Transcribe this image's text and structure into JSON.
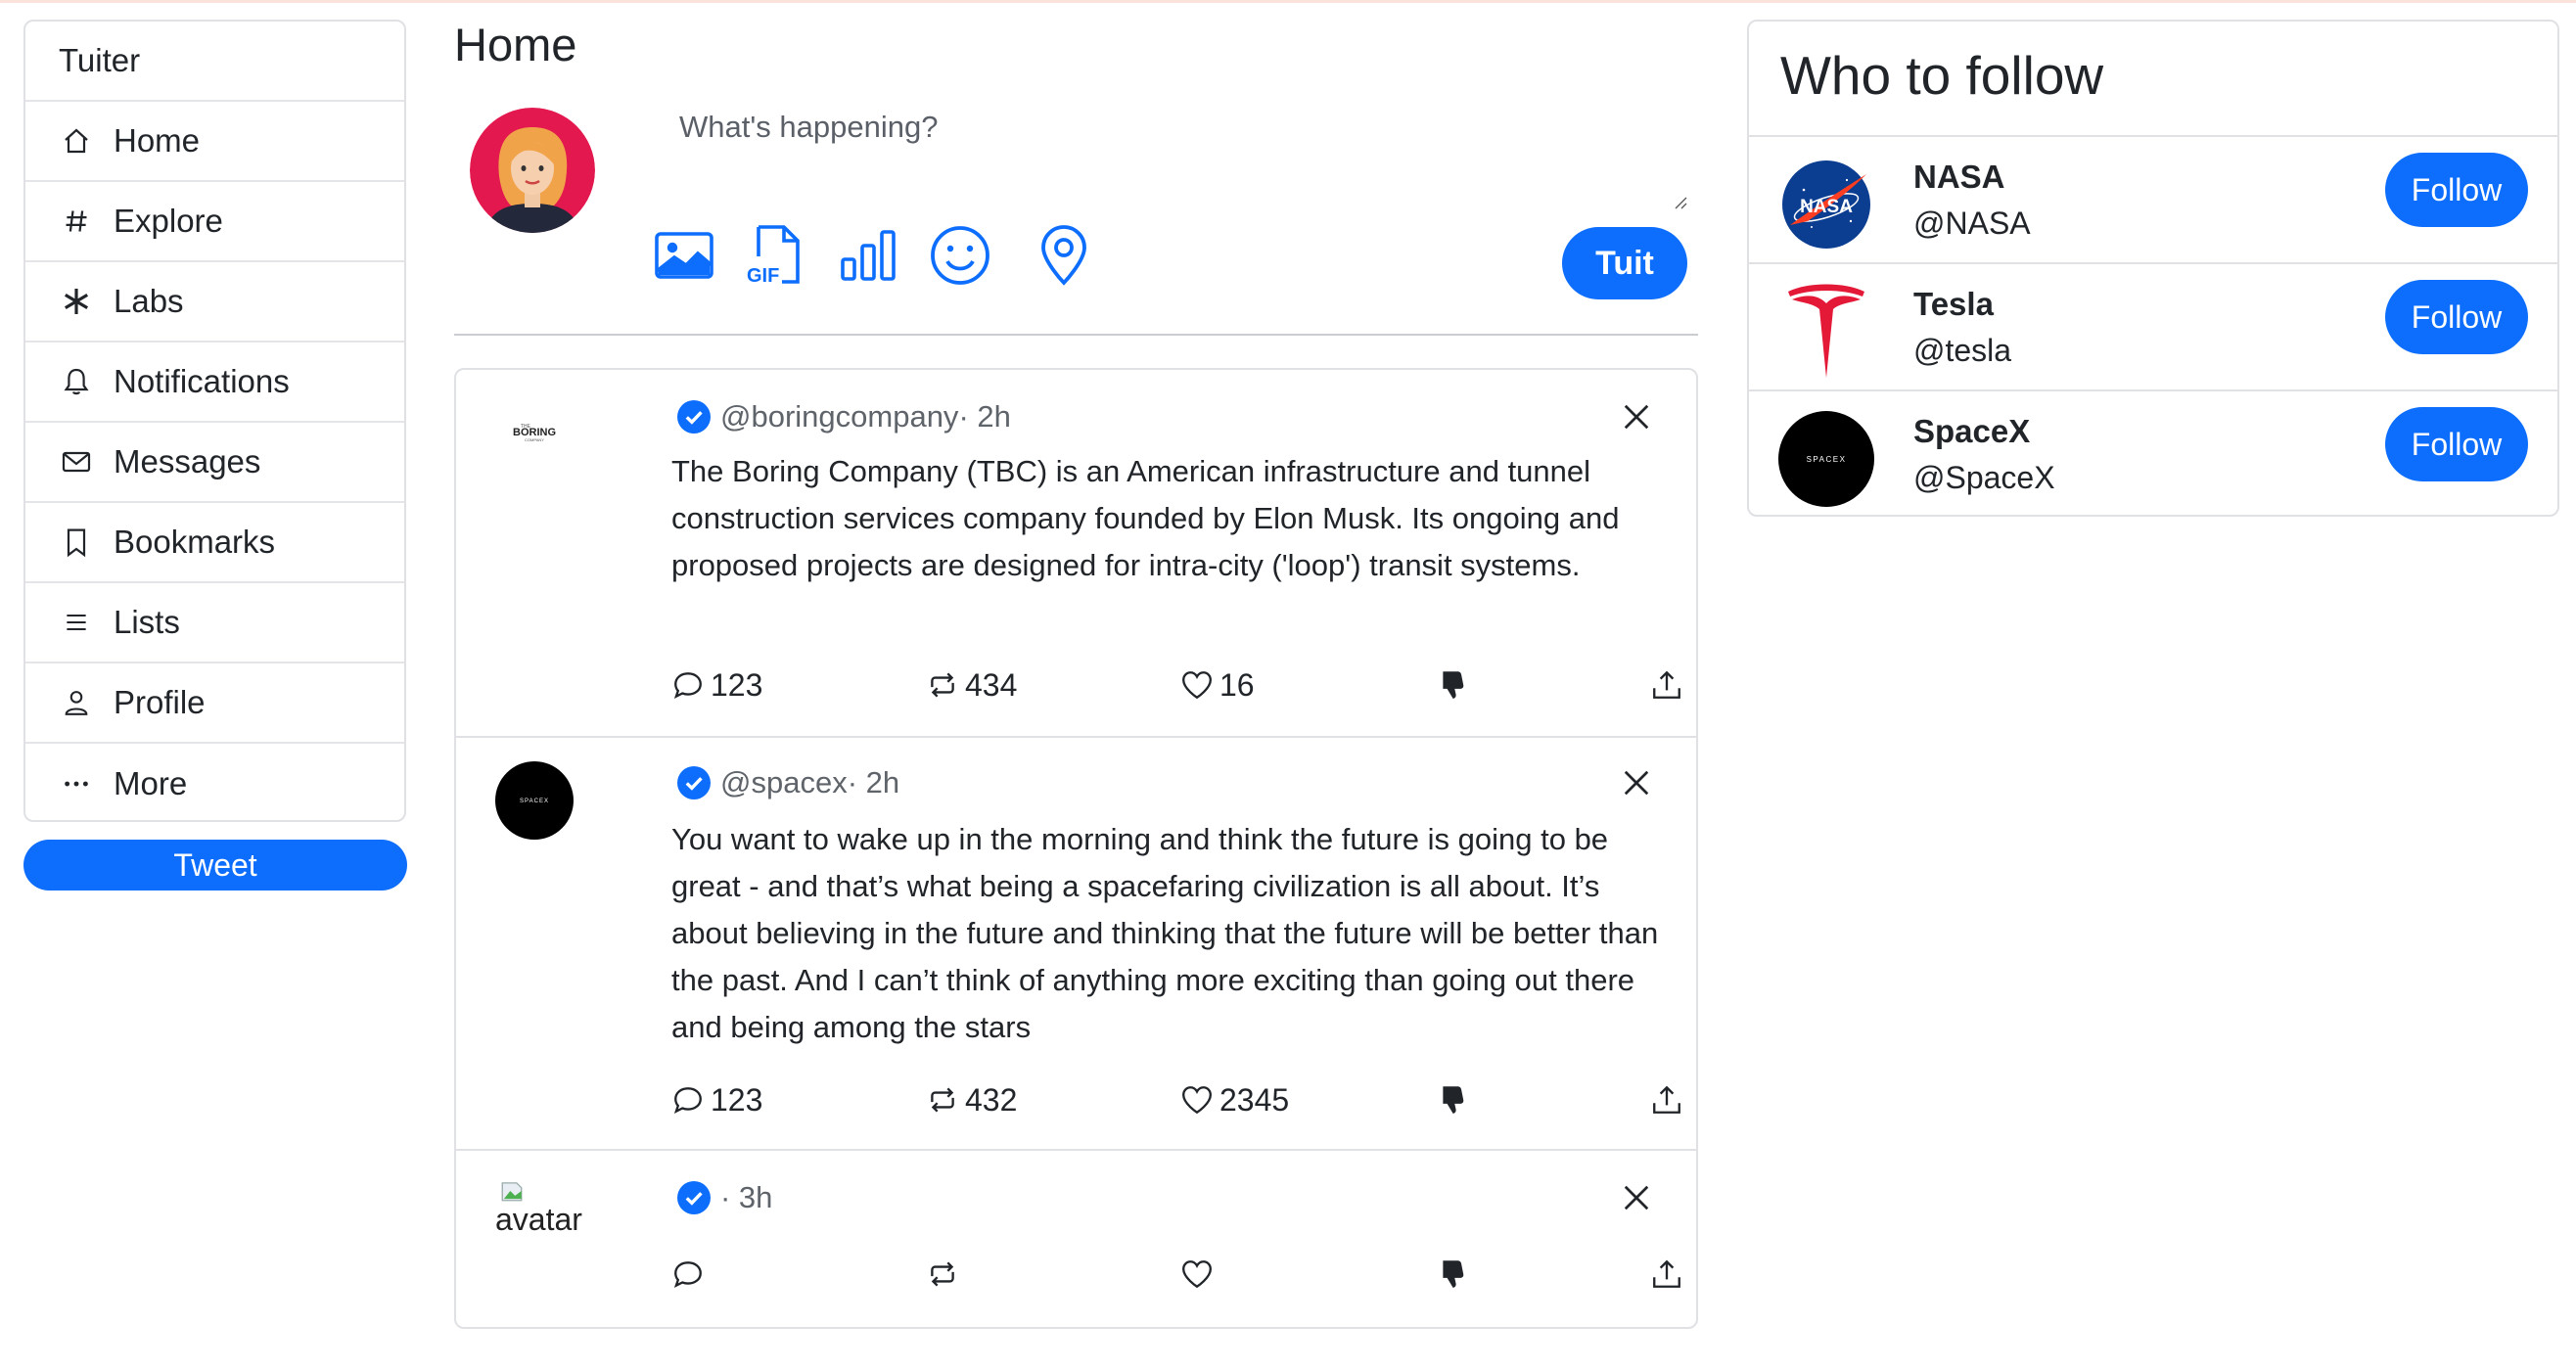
{
  "nav": {
    "brand": "Tuiter",
    "items": [
      {
        "label": "Home",
        "icon": "home-icon"
      },
      {
        "label": "Explore",
        "icon": "hash-icon"
      },
      {
        "label": "Labs",
        "icon": "asterisk-icon"
      },
      {
        "label": "Notifications",
        "icon": "bell-icon"
      },
      {
        "label": "Messages",
        "icon": "envelope-icon"
      },
      {
        "label": "Bookmarks",
        "icon": "bookmark-icon"
      },
      {
        "label": "Lists",
        "icon": "list-icon"
      },
      {
        "label": "Profile",
        "icon": "person-icon"
      },
      {
        "label": "More",
        "icon": "more-icon"
      }
    ],
    "tweet_button": "Tweet"
  },
  "main": {
    "title": "Home",
    "compose": {
      "placeholder": "What's happening?",
      "tools": [
        "image-icon",
        "gif-icon",
        "poll-icon",
        "emoji-icon",
        "location-icon"
      ],
      "gif_label": "GIF",
      "submit_label": "Tuit"
    },
    "posts": [
      {
        "handle": "@boringcompany",
        "time": "· 2h",
        "text": "The Boring Company (TBC) is an American infrastructure and tunnel construction services company founded by Elon Musk. Its ongoing and proposed projects are designed for intra-city ('loop') transit systems.",
        "replies": "123",
        "retweets": "434",
        "likes": "16",
        "avatar_logo": "BORING"
      },
      {
        "handle": "@spacex",
        "time": "· 2h",
        "text": "You want to wake up in the morning and think the future is going to be great - and that’s what being a spacefaring civilization is all about. It’s about believing in the future and thinking that the future will be better than the past. And I can’t think of anything more exciting than going out there and being among the stars",
        "replies": "123",
        "retweets": "432",
        "likes": "2345",
        "avatar_logo": "SPACEX"
      },
      {
        "handle": "",
        "time": "· 3h",
        "text": "",
        "replies": "",
        "retweets": "",
        "likes": "",
        "avatar_alt": "avatar"
      }
    ]
  },
  "who_to_follow": {
    "title": "Who to follow",
    "accounts": [
      {
        "name": "NASA",
        "handle": "@NASA",
        "button": "Follow",
        "logo_text": "NASA"
      },
      {
        "name": "Tesla",
        "handle": "@tesla",
        "button": "Follow"
      },
      {
        "name": "SpaceX",
        "handle": "@SpaceX",
        "button": "Follow",
        "logo_text": "SPACEX"
      }
    ]
  },
  "colors": {
    "accent": "#0d6efd",
    "text": "#212529",
    "muted": "#5f646b",
    "border": "#dfe1e4",
    "nasa_blue": "#0b3d91",
    "nasa_red": "#fc3d21",
    "tesla_red": "#e31937"
  }
}
